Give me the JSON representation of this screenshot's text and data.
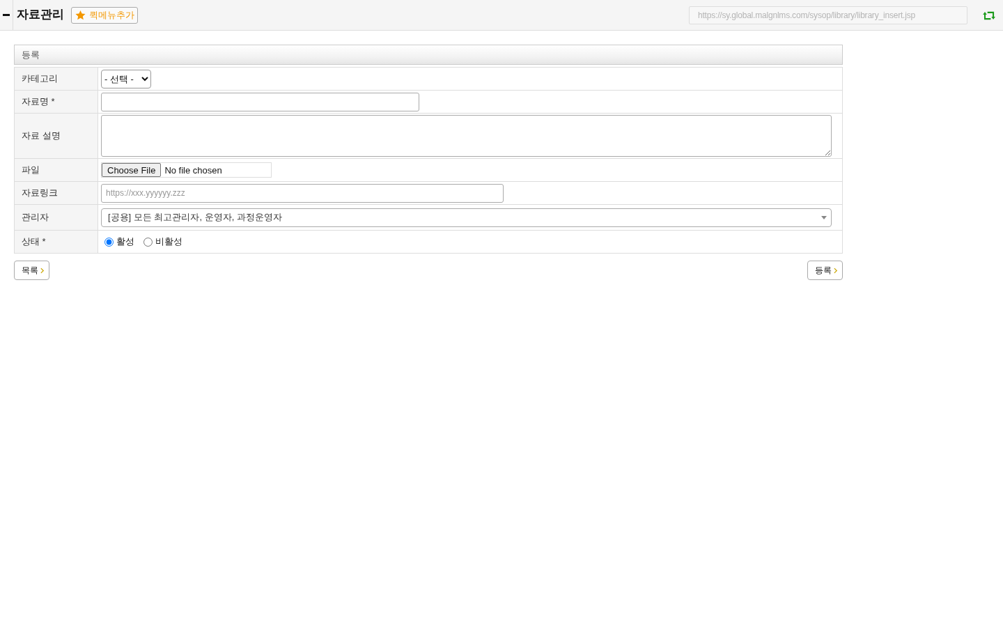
{
  "header": {
    "title": "자료관리",
    "quick_menu_button": "퀵메뉴추가",
    "url": "https://sy.global.malgnlms.com/sysop/library/library_insert.jsp"
  },
  "form": {
    "title": "등록",
    "rows": [
      {
        "kind": "select",
        "label": "카테고리",
        "value": "- 선택 -"
      },
      {
        "kind": "text",
        "label": "자료명 *"
      },
      {
        "kind": "textarea",
        "label": "자료 설명"
      },
      {
        "kind": "file",
        "label": "파일",
        "button": "Choose File",
        "status": "No file chosen"
      },
      {
        "kind": "text",
        "label": "자료링크",
        "placeholder": "https://xxx.yyyyyy.zzz"
      },
      {
        "kind": "combo",
        "label": "관리자",
        "value": "[공용] 모든 최고관리자, 운영자, 과정운영자"
      },
      {
        "kind": "radio",
        "label": "상태 *",
        "options": [
          {
            "label": "활성",
            "selected": true
          },
          {
            "label": "비활성",
            "selected": false
          }
        ]
      }
    ]
  },
  "buttons": {
    "list": "목록",
    "submit": "등록"
  }
}
